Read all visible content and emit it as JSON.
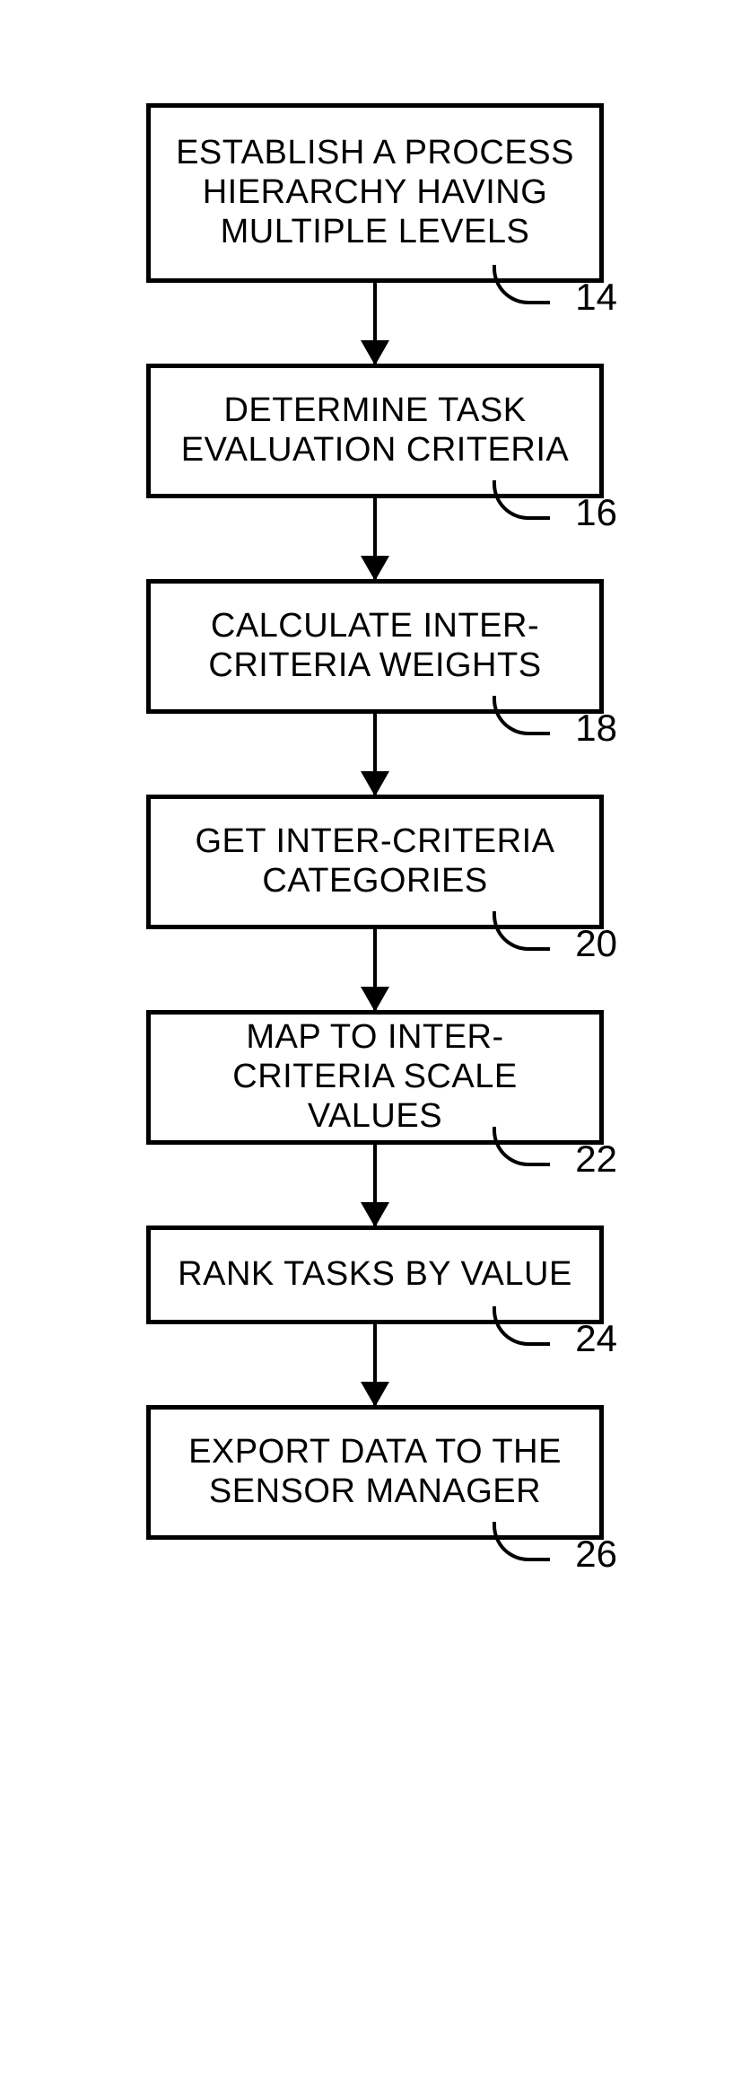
{
  "chart_data": {
    "type": "flowchart",
    "direction": "top-to-bottom",
    "nodes": [
      {
        "id": "14",
        "text": "ESTABLISH A PROCESS HIERARCHY HAVING MULTIPLE LEVELS"
      },
      {
        "id": "16",
        "text": "DETERMINE TASK EVALUATION CRITERIA"
      },
      {
        "id": "18",
        "text": "CALCULATE INTER-CRITERIA WEIGHTS"
      },
      {
        "id": "20",
        "text": "GET INTER-CRITERIA CATEGORIES"
      },
      {
        "id": "22",
        "text": "MAP TO INTER-CRITERIA SCALE VALUES"
      },
      {
        "id": "24",
        "text": "RANK TASKS BY VALUE"
      },
      {
        "id": "26",
        "text": "EXPORT DATA TO THE SENSOR MANAGER"
      }
    ],
    "edges": [
      {
        "from": "14",
        "to": "16"
      },
      {
        "from": "16",
        "to": "18"
      },
      {
        "from": "18",
        "to": "20"
      },
      {
        "from": "20",
        "to": "22"
      },
      {
        "from": "22",
        "to": "24"
      },
      {
        "from": "24",
        "to": "26"
      }
    ]
  }
}
